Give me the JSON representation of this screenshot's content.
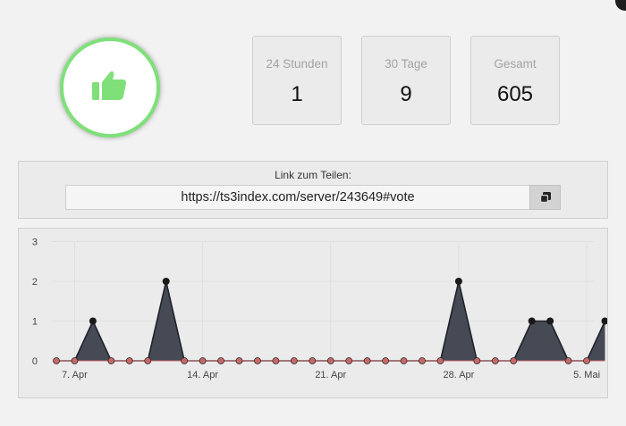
{
  "window": {
    "close_icon": "close-icon"
  },
  "vote": {
    "icon": "thumbs-up-icon",
    "accent_color": "#7fe07a"
  },
  "stats": [
    {
      "label": "24 Stunden",
      "value": "1"
    },
    {
      "label": "30 Tage",
      "value": "9"
    },
    {
      "label": "Gesamt",
      "value": "605"
    }
  ],
  "share": {
    "label": "Link zum Teilen:",
    "url": "https://ts3index.com/server/243649#vote",
    "copy_icon": "copy-icon"
  },
  "chart_data": {
    "type": "area",
    "xlabel": "",
    "ylabel": "",
    "ylim": [
      0,
      3
    ],
    "y_ticks": [
      "0",
      "1",
      "2",
      "3"
    ],
    "x_tick_labels": [
      {
        "day": 1,
        "label": "7. Apr"
      },
      {
        "day": 8,
        "label": "14. Apr"
      },
      {
        "day": 15,
        "label": "21. Apr"
      },
      {
        "day": 22,
        "label": "28. Apr"
      },
      {
        "day": 29,
        "label": "5. Mai"
      }
    ],
    "x": [
      0,
      1,
      2,
      3,
      4,
      5,
      6,
      7,
      8,
      9,
      10,
      11,
      12,
      13,
      14,
      15,
      16,
      17,
      18,
      19,
      20,
      21,
      22,
      23,
      24,
      25,
      26,
      27,
      28,
      29,
      30
    ],
    "series": [
      {
        "values": [
          0,
          0,
          1,
          0,
          0,
          0,
          2,
          0,
          0,
          0,
          0,
          0,
          0,
          0,
          0,
          0,
          0,
          0,
          0,
          0,
          0,
          0,
          2,
          0,
          0,
          0,
          1,
          1,
          0,
          0,
          1
        ]
      }
    ],
    "grid": true,
    "colors": {
      "area": "#454a54",
      "zero_marker": "#c96868",
      "point_marker": "#1a1a1a"
    }
  }
}
